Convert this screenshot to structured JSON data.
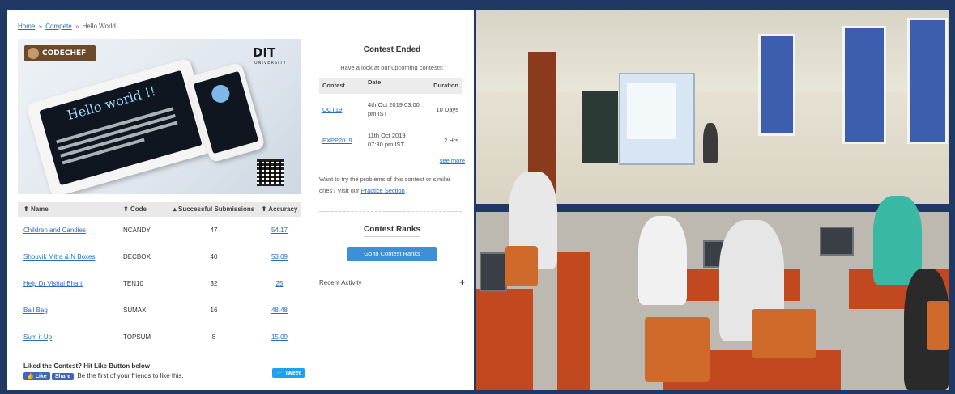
{
  "breadcrumb": {
    "home": "Home",
    "compete": "Compete",
    "current": "Hello World",
    "separator": "»"
  },
  "banner": {
    "codechef_logo": "CODECHEF",
    "dit_logo": "DIT",
    "dit_sub": "UNIVERSITY",
    "headline": "Hello world !!"
  },
  "problems": {
    "headers": {
      "name": "Name",
      "code": "Code",
      "successful": "Successful Submissions",
      "accuracy": "Accuracy"
    },
    "rows": [
      {
        "name": "Children and Candies",
        "code": "NCANDY",
        "successful": "47",
        "accuracy": "54.17"
      },
      {
        "name": "Shouvik Mitra & N Boxes",
        "code": "DECBOX",
        "successful": "40",
        "accuracy": "53.09"
      },
      {
        "name": "Help Dr Vishal Bharti",
        "code": "TEN10",
        "successful": "32",
        "accuracy": "25"
      },
      {
        "name": "Ball Bag",
        "code": "SUMAX",
        "successful": "16",
        "accuracy": "48.48"
      },
      {
        "name": "Sum it Up",
        "code": "TOPSUM",
        "successful": "8",
        "accuracy": "15.09"
      }
    ]
  },
  "like": {
    "title": "Liked the Contest? Hit Like Button below",
    "like_label": "Like",
    "share_label": "Share",
    "note": "Be the first of your friends to like this.",
    "tweet_label": "Tweet"
  },
  "sidebar": {
    "title": "Contest Ended",
    "subtitle": "Have a look at our upcoming contests:",
    "table_headers": {
      "contest": "Contest",
      "date": "Date",
      "duration": "Duration"
    },
    "contests": [
      {
        "name": "OCT19",
        "date": "4th Oct 2019 03:00 pm IST",
        "duration": "10 Days"
      },
      {
        "name": "EXPP2019",
        "date": "11th Oct 2019 07:30 pm IST",
        "duration": "2 Hrs"
      }
    ],
    "see_more": "see more",
    "try_text": "Want to try the problems of this contest or similar ones? Visit our",
    "practice_link": "Practice Section",
    "ranks_title": "Contest Ranks",
    "ranks_button": "Go to Contest Ranks",
    "recent_activity": "Recent Activity"
  }
}
